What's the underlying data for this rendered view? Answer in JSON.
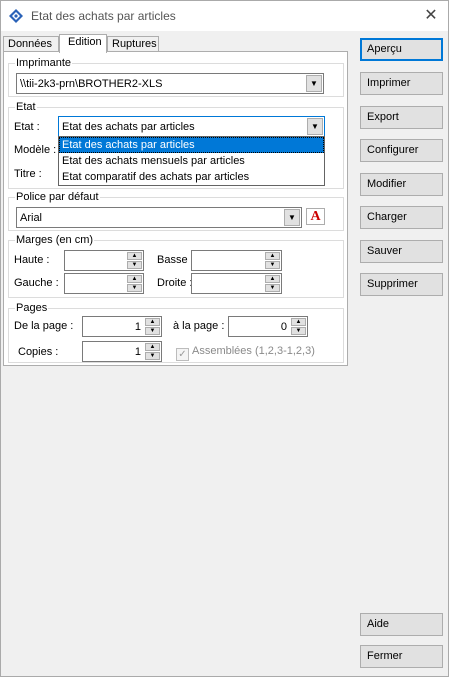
{
  "window": {
    "title": "Etat des achats par articles",
    "close_glyph": "✕"
  },
  "tabs": [
    "Données",
    "Edition",
    "Ruptures"
  ],
  "imprimante": {
    "group_title": "Imprimante",
    "value": "\\\\tii-2k3-prn\\BROTHER2-XLS"
  },
  "etat": {
    "group_title": "Etat",
    "etat_label": "Etat :",
    "modele_label": "Modèle :",
    "titre_label": "Titre :",
    "selected": "Etat des achats par articles",
    "options": [
      "Etat des achats par articles",
      "Etat des achats mensuels par articles",
      "Etat comparatif des achats par articles"
    ]
  },
  "police": {
    "group_title": "Police par défaut",
    "value": "Arial"
  },
  "marges": {
    "group_title": "Marges (en cm)",
    "haute_label": "Haute :",
    "basse_label": "Basse :",
    "gauche_label": "Gauche :",
    "droite_label": "Droite :"
  },
  "pages": {
    "group_title": "Pages",
    "de_label": "De la page :",
    "de_value": "1",
    "a_label": "à la page :",
    "a_value": "0",
    "copies_label": "Copies :",
    "copies_value": "1",
    "assemblees_label": "Assemblées (1,2,3-1,2,3)"
  },
  "buttons": {
    "apercu": "Aperçu",
    "imprimer": "Imprimer",
    "export": "Export",
    "configurer": "Configurer",
    "modifier": "Modifier",
    "charger": "Charger",
    "sauver": "Sauver",
    "supprimer": "Supprimer",
    "aide": "Aide",
    "fermer": "Fermer"
  },
  "icons": {
    "app": "blue-diamond-icon",
    "font": "font-style-icon"
  }
}
